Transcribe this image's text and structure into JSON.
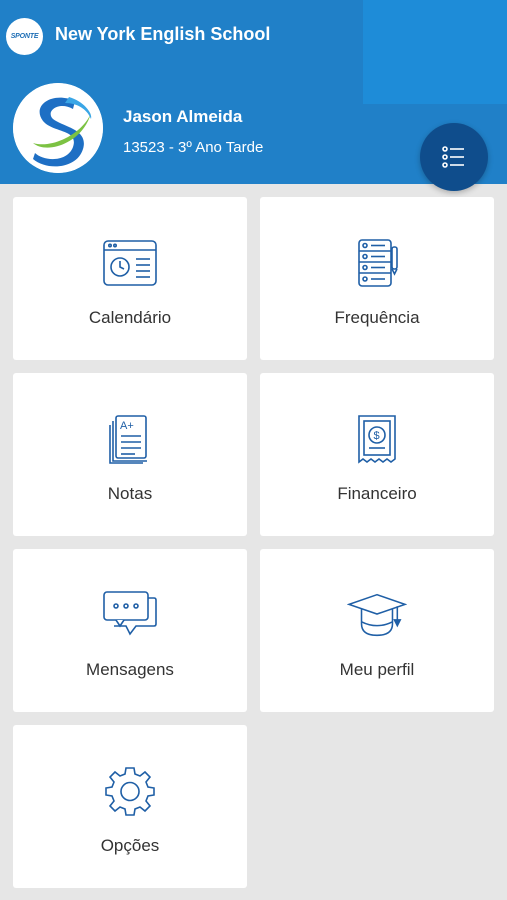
{
  "header": {
    "logo_text": "SPONTE",
    "school_name": "New York English School",
    "user_name": "Jason Almeida",
    "user_class": "13523 - 3º Ano Tarde"
  },
  "colors": {
    "header_bg": "#2080c8",
    "fab_bg": "#0f4d8c",
    "icon_stroke": "#1f5fa6"
  },
  "menu": {
    "items": [
      {
        "label": "Calendário",
        "icon": "calendar-clock-icon"
      },
      {
        "label": "Frequência",
        "icon": "attendance-notebook-icon"
      },
      {
        "label": "Notas",
        "icon": "grades-document-icon"
      },
      {
        "label": "Financeiro",
        "icon": "money-receipt-icon"
      },
      {
        "label": "Mensagens",
        "icon": "message-bubbles-icon"
      },
      {
        "label": "Meu perfil",
        "icon": "graduation-cap-icon"
      },
      {
        "label": "Opções",
        "icon": "gear-icon"
      }
    ]
  }
}
